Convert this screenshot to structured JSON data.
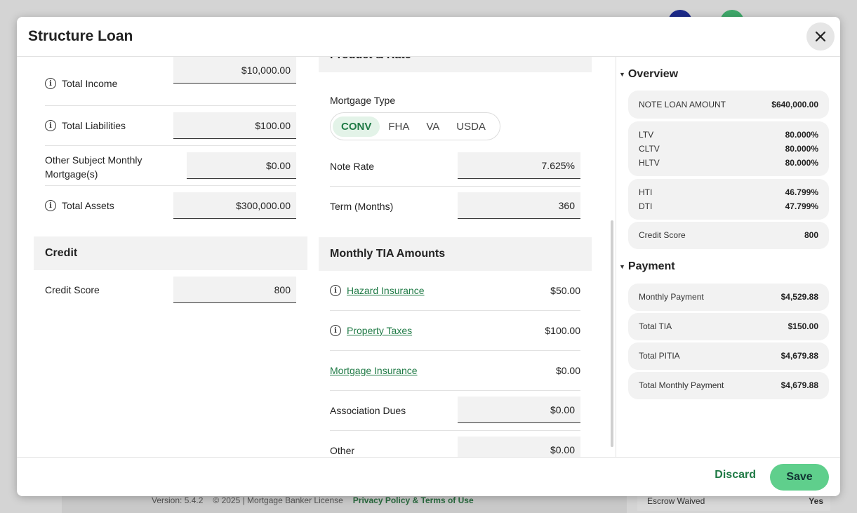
{
  "modal": {
    "title": "Structure Loan"
  },
  "income": {
    "rows": [
      {
        "label": "Total Income",
        "value": "$10,000.00"
      },
      {
        "label": "Total Liabilities",
        "value": "$100.00"
      },
      {
        "label": "Other Subject Monthly Mortgage(s)",
        "value": "$0.00"
      },
      {
        "label": "Total Assets",
        "value": "$300,000.00"
      }
    ]
  },
  "credit": {
    "heading": "Credit",
    "score_label": "Credit Score",
    "score_value": "800"
  },
  "product": {
    "heading": "Product & Rate",
    "mortgage_type_label": "Mortgage Type",
    "mortgage_types": [
      "CONV",
      "FHA",
      "VA",
      "USDA"
    ],
    "selected": "CONV",
    "note_rate_label": "Note Rate",
    "note_rate_value": "7.625%",
    "term_label": "Term (Months)",
    "term_value": "360"
  },
  "tia": {
    "heading": "Monthly TIA Amounts",
    "hazard_label": "Hazard Insurance",
    "hazard_value": "$50.00",
    "taxes_label": "Property Taxes",
    "taxes_value": "$100.00",
    "mi_label": "Mortgage Insurance",
    "mi_value": "$0.00",
    "dues_label": "Association Dues",
    "dues_value": "$0.00",
    "other_label": "Other",
    "other_value": "$0.00"
  },
  "overview": {
    "heading": "Overview",
    "note_loan_label": "NOTE LOAN AMOUNT",
    "note_loan_value": "$640,000.00",
    "ltv_label": "LTV",
    "ltv_value": "80.000%",
    "cltv_label": "CLTV",
    "cltv_value": "80.000%",
    "hltv_label": "HLTV",
    "hltv_value": "80.000%",
    "hti_label": "HTI",
    "hti_value": "46.799%",
    "dti_label": "DTI",
    "dti_value": "47.799%",
    "credit_label": "Credit Score",
    "credit_value": "800"
  },
  "payment": {
    "heading": "Payment",
    "monthly_label": "Monthly Payment",
    "monthly_value": "$4,529.88",
    "tia_label": "Total TIA",
    "tia_value": "$150.00",
    "pitia_label": "Total PITIA",
    "pitia_value": "$4,679.88",
    "total_label": "Total Monthly Payment",
    "total_value": "$4,679.88"
  },
  "footer": {
    "discard": "Discard",
    "save": "Save"
  },
  "background": {
    "version": "Version: 5.4.2",
    "license": "© 2025 | Mortgage Banker License",
    "privacy": "Privacy Policy & Terms of Use",
    "escrow_label": "Escrow Waived",
    "escrow_value": "Yes"
  },
  "colors": {
    "accent": "#1f7a45",
    "save_bg": "#5fcf8c",
    "field_bg": "#f2f2f2"
  }
}
